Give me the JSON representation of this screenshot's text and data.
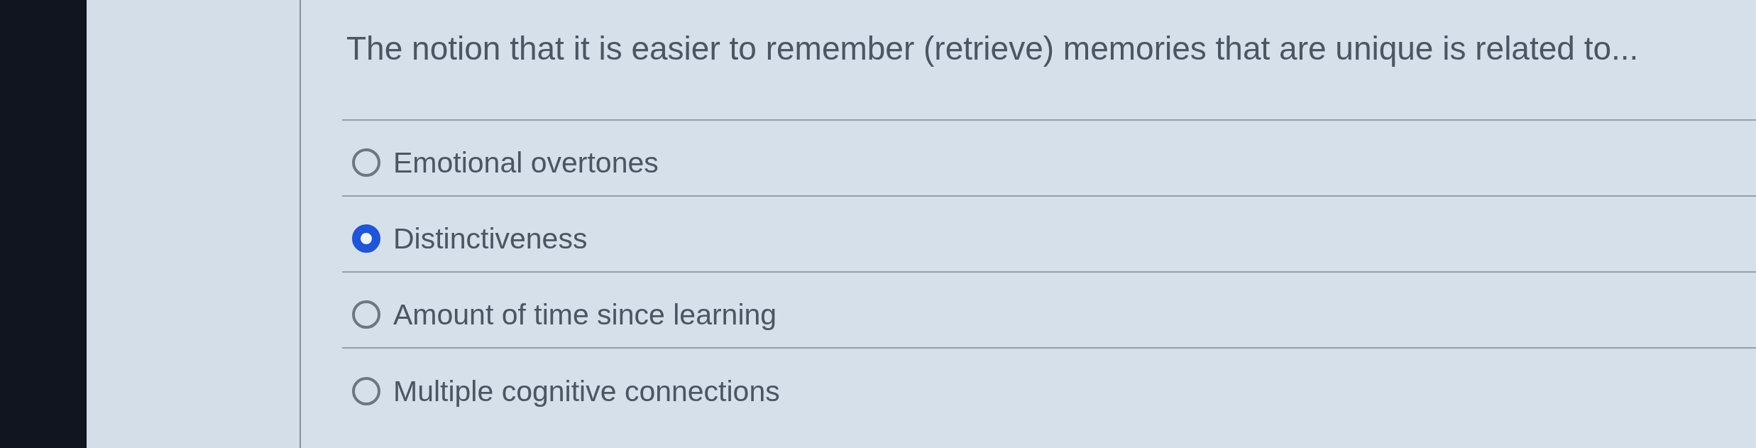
{
  "question": {
    "text": "The notion that it is easier to remember (retrieve) memories that are unique is related to..."
  },
  "options": [
    {
      "label": "Emotional overtones",
      "selected": false
    },
    {
      "label": "Distinctiveness",
      "selected": true
    },
    {
      "label": "Amount of time since learning",
      "selected": false
    },
    {
      "label": "Multiple cognitive connections",
      "selected": false
    }
  ]
}
